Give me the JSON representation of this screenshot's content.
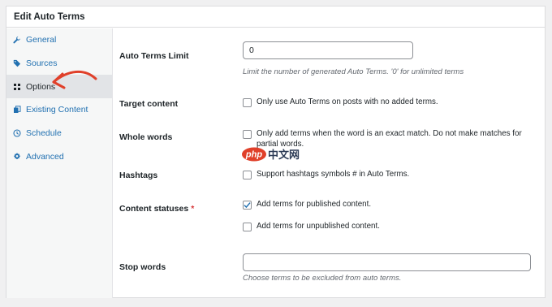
{
  "header": {
    "title": "Edit Auto Terms"
  },
  "sidebar": {
    "items": [
      {
        "label": "General",
        "icon": "wrench-icon"
      },
      {
        "label": "Sources",
        "icon": "tag-icon"
      },
      {
        "label": "Options",
        "icon": "grid-icon",
        "active": true
      },
      {
        "label": "Existing Content",
        "icon": "copy-icon"
      },
      {
        "label": "Schedule",
        "icon": "clock-icon"
      },
      {
        "label": "Advanced",
        "icon": "gear-icon"
      }
    ]
  },
  "form": {
    "limit": {
      "label": "Auto Terms Limit",
      "value": "0",
      "description": "Limit the number of generated Auto Terms. '0' for unlimited terms"
    },
    "target": {
      "label": "Target content",
      "option": "Only use Auto Terms on posts with no added terms.",
      "checked": false
    },
    "whole_words": {
      "label": "Whole words",
      "option_line1": "Only add terms when the word is an exact match. Do not make matches for",
      "option_line2": "partial words.",
      "checked": false
    },
    "hashtags": {
      "label": "Hashtags",
      "option": "Support hashtags symbols # in Auto Terms.",
      "checked": false
    },
    "statuses": {
      "label": "Content statuses",
      "required_mark": "*",
      "options": [
        {
          "label": "Add terms for published content.",
          "checked": true
        },
        {
          "label": "Add terms for unpublished content.",
          "checked": false
        }
      ]
    },
    "stop_words": {
      "label": "Stop words",
      "value": "",
      "description": "Choose terms to be excluded from auto terms."
    }
  },
  "watermark": {
    "text": "中文网",
    "badge": "php"
  },
  "colors": {
    "accent": "#2271b1",
    "checkmark": "#2271b1",
    "arrow": "#e0402a",
    "required": "#d63638"
  }
}
